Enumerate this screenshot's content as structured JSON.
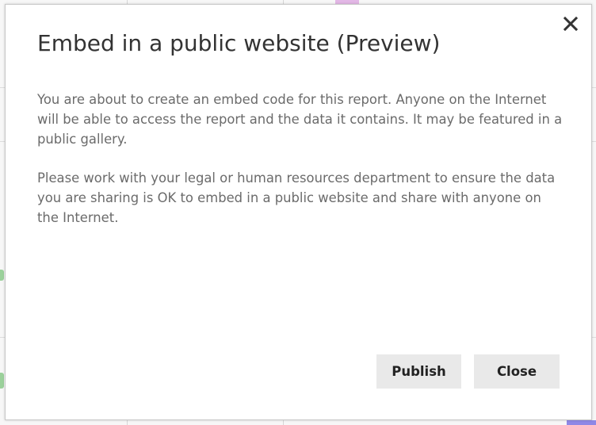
{
  "dialog": {
    "title": "Embed in a public website (Preview)",
    "close_icon": "close-icon",
    "paragraphs": [
      "You are about to create an embed code for this report. Anyone on the Internet will be able to access the report and the data it contains. It may be featured in a public gallery.",
      "Please work with your legal or human resources department to ensure the data you are sharing is OK to embed in a public website and share with anyone on the Internet."
    ],
    "buttons": {
      "publish_label": "Publish",
      "close_label": "Close"
    }
  },
  "colors": {
    "title_text": "#333333",
    "body_text": "#6b6b6b",
    "button_bg": "#e9e9e9",
    "overlay_accent_pink": "#e3b8e6",
    "overlay_accent_purple": "#8f88e6"
  }
}
